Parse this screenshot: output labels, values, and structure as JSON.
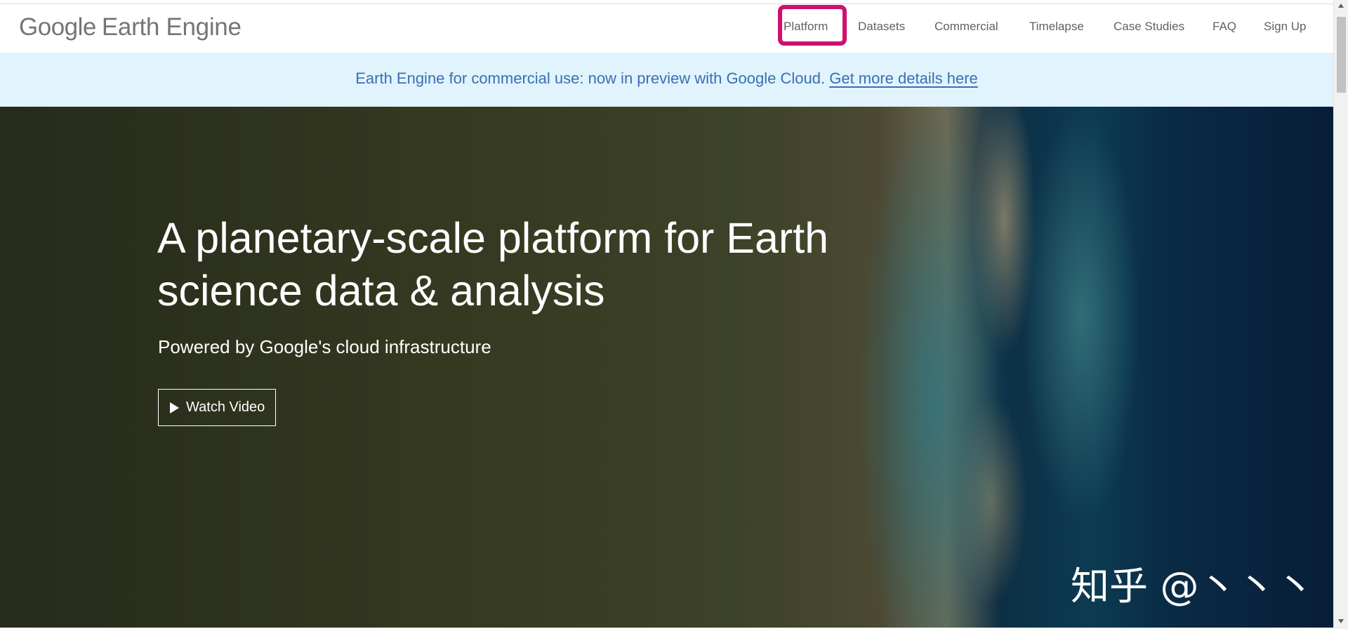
{
  "header": {
    "logo": {
      "brand": "Google",
      "product": "Earth Engine"
    },
    "nav": [
      {
        "label": "Platform"
      },
      {
        "label": "Datasets"
      },
      {
        "label": "Commercial"
      },
      {
        "label": "Timelapse"
      },
      {
        "label": "Case Studies"
      },
      {
        "label": "FAQ"
      },
      {
        "label": "Sign Up"
      }
    ]
  },
  "banner": {
    "text": "Earth Engine for commercial use: now in preview with Google Cloud.",
    "link_label": "Get more details here"
  },
  "hero": {
    "title_line1": "A planetary-scale platform for Earth",
    "title_line2": "science data & analysis",
    "subtitle": "Powered by Google's cloud infrastructure",
    "watch_button": "Watch Video",
    "play_icon": "play-icon"
  },
  "watermark": "知乎 @丶丶丶",
  "colors": {
    "highlight": "#d0106f",
    "banner_bg": "#e1f3fc",
    "banner_text": "#3a6fb5",
    "nav_text": "#616161"
  }
}
